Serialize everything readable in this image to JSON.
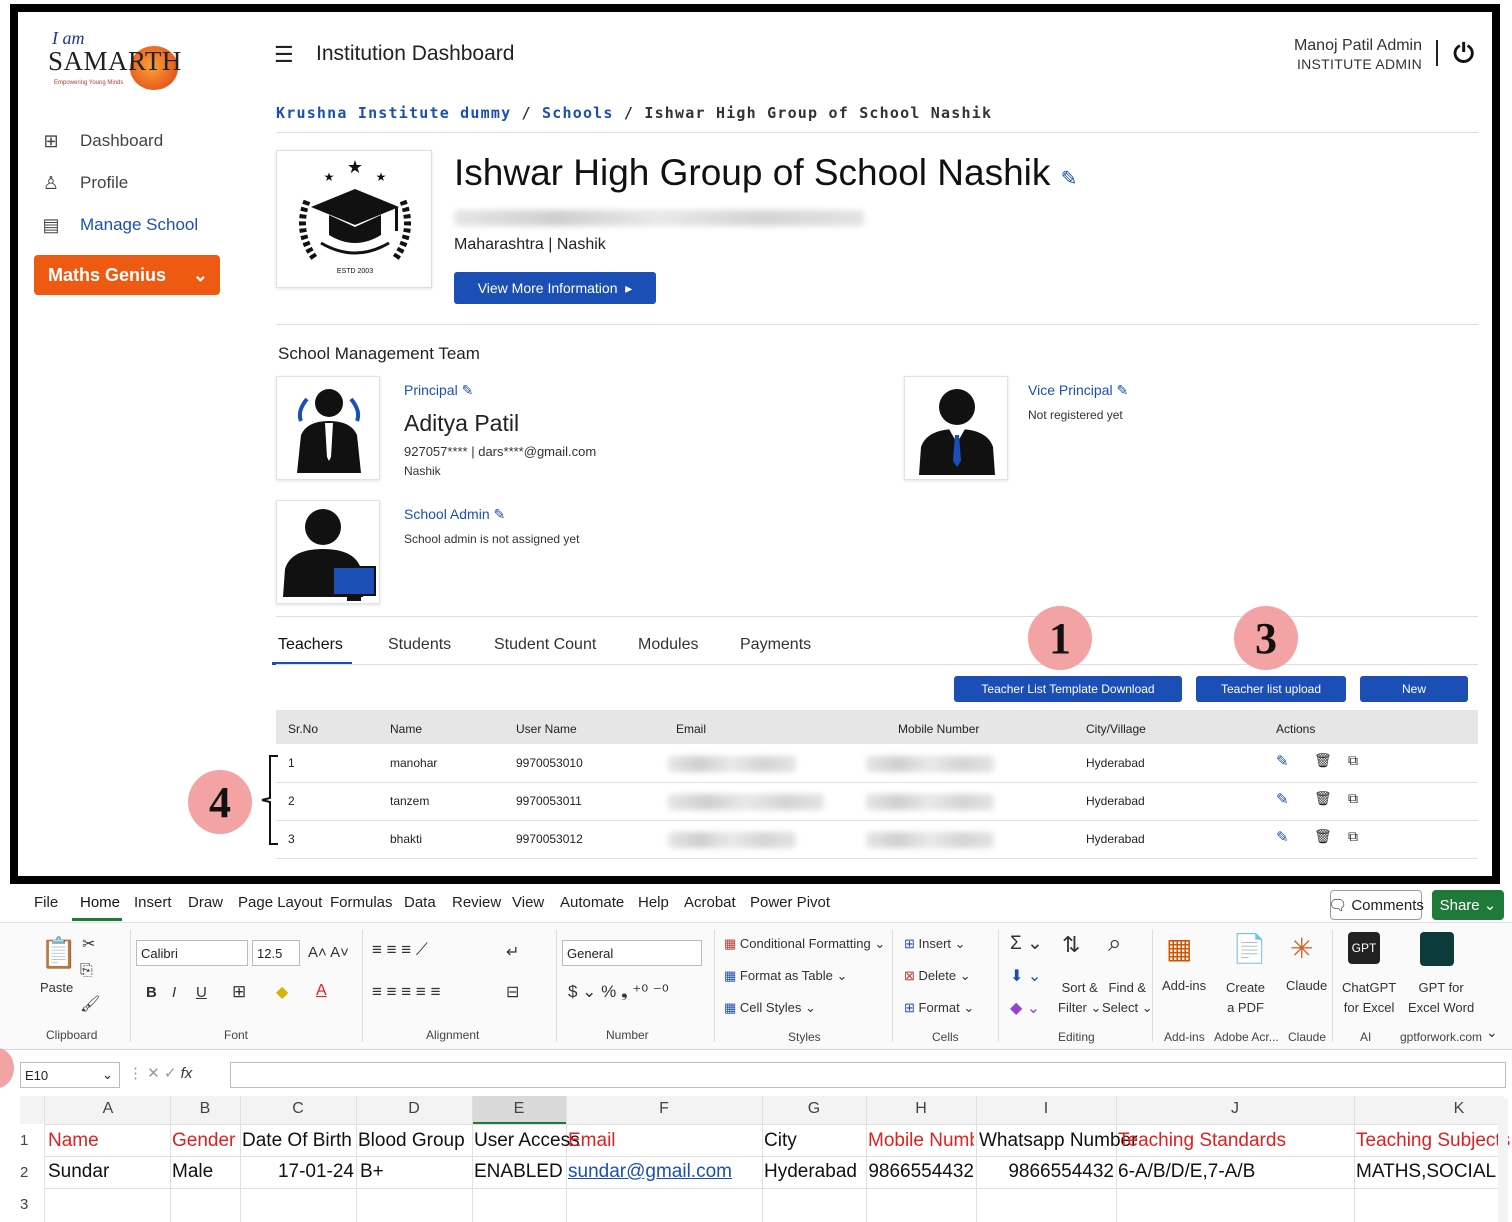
{
  "sidebar": {
    "logo_iam": "I am",
    "logo_name": "SAMARTH",
    "logo_tag": "Empowering Young Minds",
    "items": [
      {
        "label": "Dashboard",
        "icon": "grid-icon"
      },
      {
        "label": "Profile",
        "icon": "user-icon"
      },
      {
        "label": "Manage School",
        "icon": "school-icon"
      }
    ],
    "program": "Maths Genius"
  },
  "header": {
    "title": "Institution Dashboard",
    "user_name": "Manoj Patil Admin",
    "user_role": "INSTITUTE ADMIN"
  },
  "breadcrumb": [
    "Krushna Institute dummy",
    "Schools",
    "Ishwar High Group of School Nashik"
  ],
  "breadcrumb_sep": "/",
  "school": {
    "name": "Ishwar High Group of School Nashik",
    "location": "Maharashtra | Nashik",
    "view_more": "View More Information",
    "estd": "ESTD 2003"
  },
  "management": {
    "heading": "School Management Team",
    "principal": {
      "role": "Principal",
      "name": "Aditya Patil",
      "contact": "927057**** | dars****@gmail.com",
      "city": "Nashik"
    },
    "vice_principal": {
      "role": "Vice Principal",
      "status": "Not registered yet"
    },
    "school_admin": {
      "role": "School Admin",
      "status": "School admin is not assigned yet"
    }
  },
  "tabs": [
    "Teachers",
    "Students",
    "Student Count",
    "Modules",
    "Payments"
  ],
  "buttons": {
    "template_download": "Teacher List Template Download",
    "list_upload": "Teacher list upload",
    "new": "New"
  },
  "callouts": [
    "1",
    "3",
    "4"
  ],
  "table": {
    "headers": [
      "Sr.No",
      "Name",
      "User Name",
      "Email",
      "Mobile Number",
      "City/Village",
      "Actions"
    ],
    "rows": [
      {
        "sr": "1",
        "name": "manohar",
        "user": "9970053010",
        "city": "Hyderabad"
      },
      {
        "sr": "2",
        "name": "tanzem",
        "user": "9970053011",
        "city": "Hyderabad"
      },
      {
        "sr": "3",
        "name": "bhakti",
        "user": "9970053012",
        "city": "Hyderabad"
      }
    ]
  },
  "excel": {
    "menu": [
      "File",
      "Home",
      "Insert",
      "Draw",
      "Page Layout",
      "Formulas",
      "Data",
      "Review",
      "View",
      "Automate",
      "Help",
      "Acrobat",
      "Power Pivot"
    ],
    "comments": "Comments",
    "share": "Share",
    "font_name": "Calibri",
    "font_size": "12.5",
    "number_format": "General",
    "paste": "Paste",
    "groups": [
      "Clipboard",
      "Font",
      "Alignment",
      "Number",
      "Styles",
      "Cells",
      "Editing",
      "Add-ins",
      "Adobe Acr...",
      "Claude",
      "AI",
      "gptforwork.com"
    ],
    "styles": [
      "Conditional Formatting",
      "Format as Table",
      "Cell Styles"
    ],
    "cells": [
      "Insert",
      "Delete",
      "Format"
    ],
    "editing": [
      "Sort &",
      "Filter",
      "Find &",
      "Select"
    ],
    "addins": [
      "Add-ins",
      "Create",
      "a PDF",
      "Claude",
      "ChatGPT",
      "for Excel",
      "GPT for",
      "Excel Word"
    ],
    "name_box": "E10",
    "fx": "fx",
    "columns": [
      "A",
      "B",
      "C",
      "D",
      "E",
      "F",
      "G",
      "H",
      "I",
      "J",
      "K"
    ],
    "row_numbers": [
      "1",
      "2",
      "3"
    ],
    "row1": [
      "Name",
      "Gender",
      "Date Of Birth",
      "Blood Group",
      "User Access",
      "Email",
      "City",
      "Mobile Numbe",
      "Whatsapp Number",
      "Teaching Standards",
      "Teaching Subjects"
    ],
    "row2": [
      "Sundar",
      "Male",
      "17-01-24",
      "B+",
      "ENABLED",
      "sundar@gmail.com",
      "Hyderabad",
      "9866554432",
      "9866554432",
      "6-A/B/D/E,7-A/B",
      "MATHS,SOCIAL"
    ]
  }
}
